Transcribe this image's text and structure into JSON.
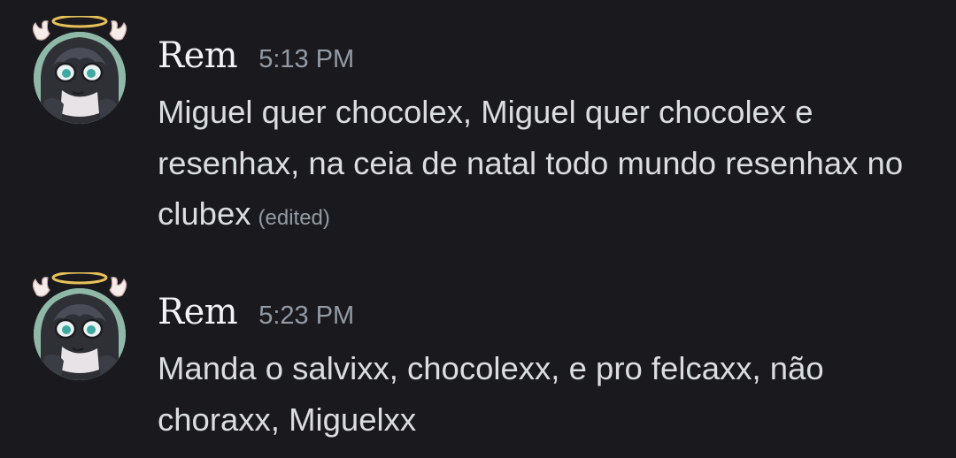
{
  "colors": {
    "background": "#1a1a1e",
    "username": "#f2f3f5",
    "text": "#dbdee1",
    "muted": "#949ba4",
    "halo": "#e6c15a"
  },
  "messages": [
    {
      "author": "Rem",
      "avatar_icon": "avatar-icon",
      "timestamp": "5:13 PM",
      "text": "Miguel quer chocolex, Miguel quer chocolex e resenhax, na ceia de natal todo mundo resenhax no clubex",
      "edited_label": "(edited)"
    },
    {
      "author": "Rem",
      "avatar_icon": "avatar-icon",
      "timestamp": "5:23 PM",
      "text": "Manda o salvixx, chocolexx, e pro felcaxx, não choraxx, Miguelxx"
    }
  ]
}
